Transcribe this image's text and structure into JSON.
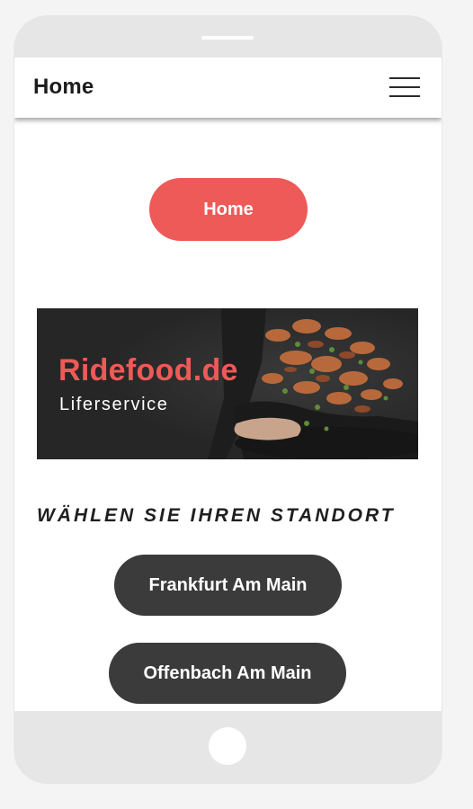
{
  "topbar": {
    "title": "Home",
    "menu_icon": "hamburger-menu-icon"
  },
  "main": {
    "home_button_label": "Home",
    "banner": {
      "title": "Ridefood.de",
      "subtitle": "Liferservice"
    },
    "location_heading": "WÄHLEN SIE IHREN STANDORT",
    "locations": [
      {
        "label": "Frankfurt Am Main"
      },
      {
        "label": "Offenbach Am Main"
      }
    ]
  },
  "colors": {
    "accent": "#ee5a57",
    "dark_button": "#3b3b3b",
    "banner_bg": "#262626",
    "device_frame": "#e6e6e6"
  }
}
